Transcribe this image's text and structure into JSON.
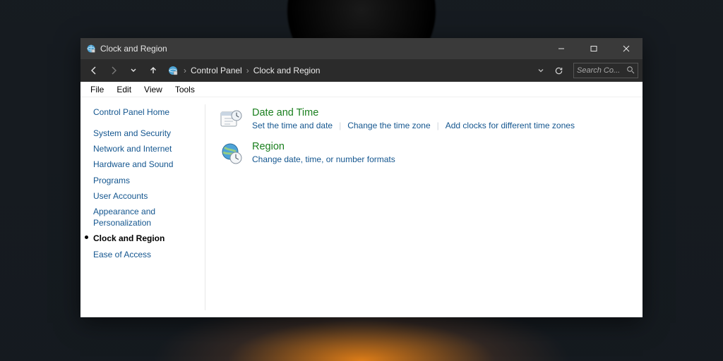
{
  "window": {
    "title": "Clock and Region"
  },
  "breadcrumb": {
    "root": "Control Panel",
    "current": "Clock and Region"
  },
  "search": {
    "placeholder": "Search Co..."
  },
  "menus": {
    "file": "File",
    "edit": "Edit",
    "view": "View",
    "tools": "Tools"
  },
  "sidebar": {
    "home": "Control Panel Home",
    "items": [
      {
        "label": "System and Security"
      },
      {
        "label": "Network and Internet"
      },
      {
        "label": "Hardware and Sound"
      },
      {
        "label": "Programs"
      },
      {
        "label": "User Accounts"
      },
      {
        "label": "Appearance and Personalization"
      },
      {
        "label": "Clock and Region"
      },
      {
        "label": "Ease of Access"
      }
    ]
  },
  "sections": {
    "datetime": {
      "title": "Date and Time",
      "tasks": [
        "Set the time and date",
        "Change the time zone",
        "Add clocks for different time zones"
      ]
    },
    "region": {
      "title": "Region",
      "tasks": [
        "Change date, time, or number formats"
      ]
    }
  }
}
